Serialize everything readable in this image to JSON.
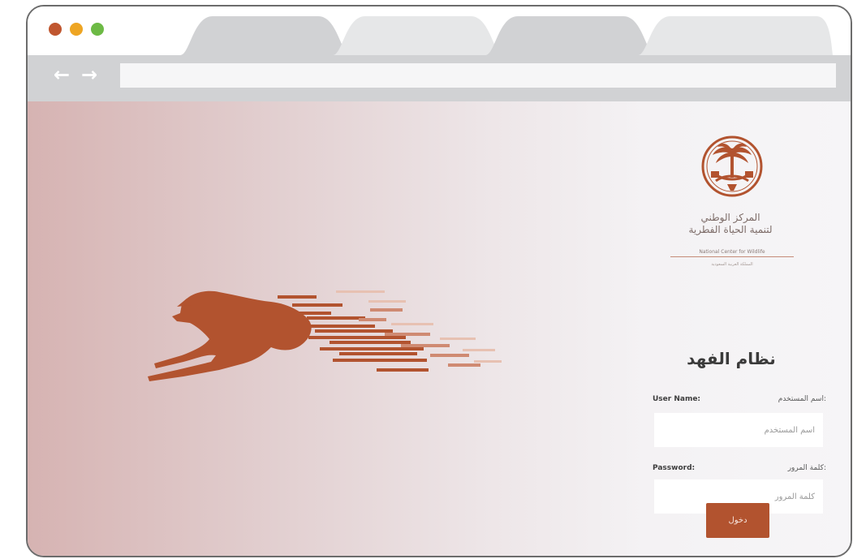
{
  "window": {
    "traffic_lights": [
      "#c0562f",
      "#eea523",
      "#6dba45"
    ],
    "tabs": [
      "",
      "",
      "",
      ""
    ],
    "toolbar": {
      "back_icon": "arrow-left-icon",
      "forward_icon": "arrow-right-icon",
      "address_value": ""
    }
  },
  "login_panel": {
    "logo_icon": "palm-swords-emblem-icon",
    "org_name_ar_line1": "المركز الوطني",
    "org_name_ar_line2": "لتنمية الحياة الفطرية",
    "org_name_en": "National Center for Wildlife",
    "org_tagline": "المملكة العربية السعودية",
    "system_title": "نظام الفهد",
    "username": {
      "label_en": "User Name:",
      "label_ar": "اسم المستخدم:",
      "placeholder": "اسم المستخدم",
      "value": ""
    },
    "password": {
      "label_en": "Password:",
      "label_ar": "كلمة المرور:",
      "placeholder": "كلمة المرور",
      "value": ""
    },
    "login_button_label": "دخول"
  },
  "colors": {
    "brand": "#b2532f",
    "toolbar": "#d1d2d4",
    "tab": "#d1d2d4",
    "tab_inactive": "#e6e7e8"
  },
  "hero": {
    "illustration": "running-cheetah-icon"
  }
}
